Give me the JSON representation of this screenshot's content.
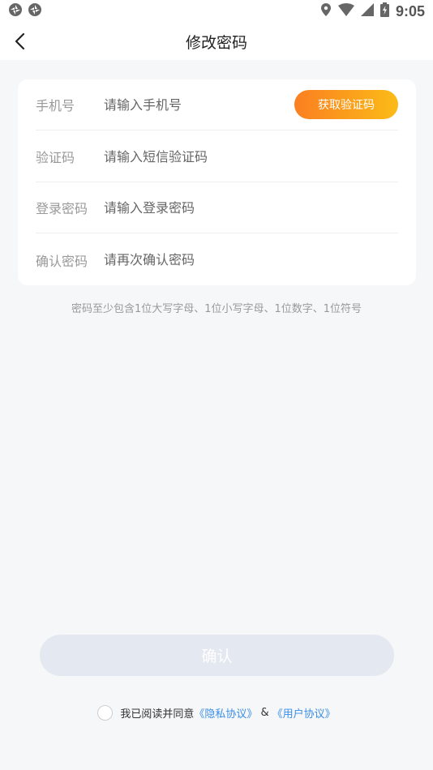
{
  "status_bar": {
    "time": "9:05",
    "left_icons": [
      "sync-icon",
      "sync-icon"
    ],
    "right_icons": [
      "location-icon",
      "wifi-icon",
      "cellular-icon",
      "battery-charging-icon"
    ]
  },
  "header": {
    "back_icon": "chevron-left-icon",
    "title": "修改密码"
  },
  "form": {
    "phone": {
      "label": "手机号",
      "placeholder": "请输入手机号",
      "value": ""
    },
    "get_code_label": "获取验证码",
    "code": {
      "label": "验证码",
      "placeholder": "请输入短信验证码",
      "value": ""
    },
    "password": {
      "label": "登录密码",
      "placeholder": "请输入登录密码",
      "value": ""
    },
    "confirm_password": {
      "label": "确认密码",
      "placeholder": "请再次确认密码",
      "value": ""
    }
  },
  "hint": "密码至少包含1位大写字母、1位小写字母、1位数字、1位符号",
  "confirm_label": "确认",
  "agreement": {
    "checked": false,
    "prefix": "我已阅读并同意",
    "privacy_link": "《隐私协议》",
    "ampersand": "&",
    "user_link": "《用户协议》"
  },
  "colors": {
    "accent_gradient_start": "#fb7f21",
    "accent_gradient_end": "#fbbb17",
    "link": "#3a8ee6",
    "button_disabled": "#e4e8f0",
    "background": "#f6f7f9"
  }
}
